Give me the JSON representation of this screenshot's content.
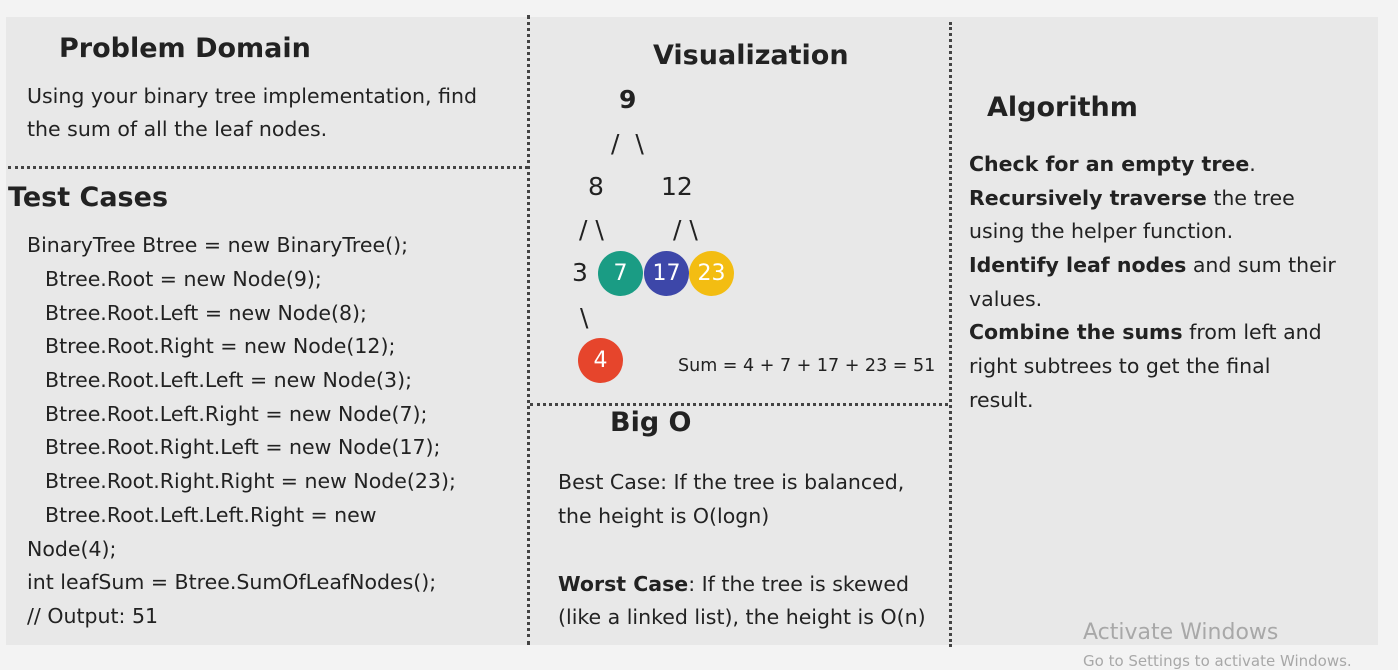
{
  "problem": {
    "title": "Problem Domain",
    "lines": [
      "Using your binary tree implementation, find",
      "the sum of all the leaf nodes."
    ]
  },
  "tests": {
    "title": "Test Cases",
    "lines": [
      "BinaryTree Btree = new BinaryTree();",
      "Btree.Root = new Node(9);",
      "Btree.Root.Left = new Node(8);",
      "Btree.Root.Right = new Node(12);",
      "Btree.Root.Left.Left = new Node(3);",
      "Btree.Root.Left.Right = new Node(7);",
      "Btree.Root.Right.Left = new Node(17);",
      "Btree.Root.Right.Right = new Node(23);",
      "Btree.Root.Left.Left.Right = new",
      "Node(4);",
      "int leafSum = Btree.SumOfLeafNodes();",
      "// Output: 51"
    ]
  },
  "visualization": {
    "title": "Visualization",
    "root": "9",
    "root_branch": "/  \\",
    "left": "8",
    "right": "12",
    "left_branch": "/ \\",
    "right_branch": "/ \\",
    "n3": "3",
    "n3_branch": "\\",
    "leaves": [
      {
        "value": "7",
        "color": "#1a9c84"
      },
      {
        "value": "17",
        "color": "#3d47a9"
      },
      {
        "value": "23",
        "color": "#f3bd12"
      },
      {
        "value": "4",
        "color": "#e6452c"
      }
    ],
    "sum": "Sum = 4 + 7 + 17 + 23 = 51"
  },
  "bigo": {
    "title": "Big O",
    "best": "Best Case: If the tree is balanced,",
    "best2": "the height is O(logn)",
    "worst_label": "Worst Case",
    "worst": ": If the tree is skewed",
    "worst2": "(like a linked list), the height is O(n)"
  },
  "algorithm": {
    "title": "Algorithm",
    "p1_b": "Check for an empty tree",
    "p1": ".",
    "p2_b": "Recursively traverse",
    "p2": " the tree",
    "p2b": "using the helper function.",
    "p3_b": "Identify leaf nodes",
    "p3": " and sum their",
    "p3b": "values.",
    "p4_b": "Combine the sums",
    "p4": " from left and",
    "p4b": "right subtrees to get the final",
    "p4c": "result."
  },
  "watermark": {
    "line1": "Activate Windows",
    "line2": "Go to Settings to activate Windows."
  }
}
